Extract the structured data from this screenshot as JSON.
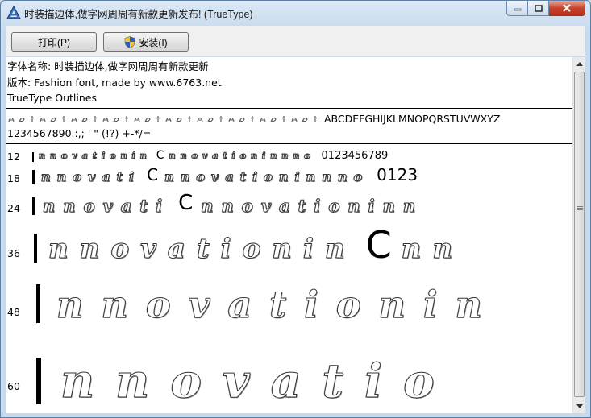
{
  "window": {
    "title": "时装描边体,做字网周周有新款更新发布! (TrueType)"
  },
  "toolbar": {
    "print_label": "打印(P)",
    "install_label": "安装(I)"
  },
  "font_info": {
    "name_line": "字体名称: 时装描边体,做字网周周有新款更新",
    "version_line": "版本: Fashion font, made by www.6763.net",
    "outline_line": "TrueType Outlines"
  },
  "charset": {
    "uppercase": "ABCDEFGHIJKLMNOPQRSTUVWXYZ",
    "digits_symbols": "1234567890.:,; ' \" (!?) +-*/="
  },
  "samples": [
    {
      "size": "12",
      "digits": "0123456789",
      "glyph_c": "C"
    },
    {
      "size": "18",
      "digits": "0123",
      "glyph_c": "C"
    },
    {
      "size": "24",
      "glyph_c": "C"
    },
    {
      "size": "36",
      "glyph_c": "C"
    },
    {
      "size": "48"
    },
    {
      "size": "60"
    }
  ],
  "sample_letters": [
    "n",
    "n",
    "o",
    "v",
    "a",
    "t",
    "i",
    "o",
    "n",
    "i",
    "n"
  ],
  "colors": {
    "close_button": "#c7432c",
    "titlebar": "#dbe8f6"
  },
  "icons": [
    "app-font-icon",
    "minimize-icon",
    "maximize-icon",
    "close-icon",
    "uac-shield-icon",
    "scroll-up-icon",
    "scroll-down-icon"
  ]
}
